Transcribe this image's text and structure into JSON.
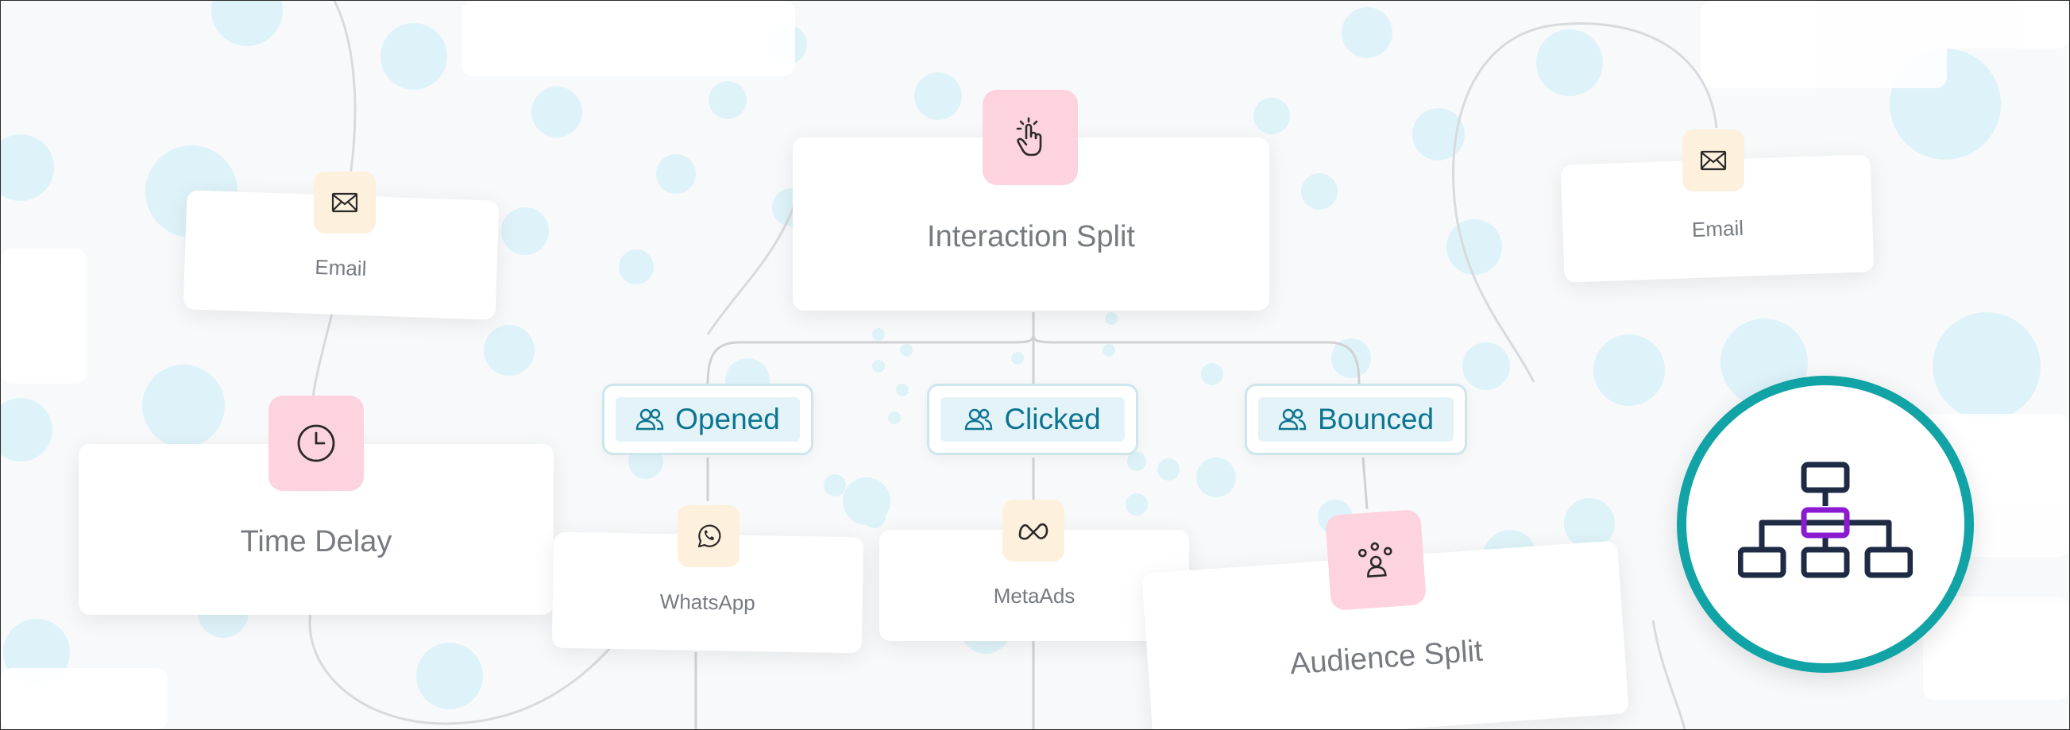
{
  "nodes": {
    "interaction_split": "Interaction Split",
    "time_delay": "Time Delay",
    "email_left": "Email",
    "email_right": "Email",
    "whatsapp": "WhatsApp",
    "metaads": "MetaAds",
    "audience_split": "Audience Split"
  },
  "branches": {
    "opened": "Opened",
    "clicked": "Clicked",
    "bounced": "Bounced"
  },
  "icons": {
    "interaction_split": "pointer-click-icon",
    "time_delay": "clock-icon",
    "email": "envelope-icon",
    "whatsapp": "whatsapp-icon",
    "metaads": "meta-logo-icon",
    "audience_split": "people-group-icon",
    "branch": "users-icon",
    "badge": "flowchart-hierarchy-icon"
  },
  "colors": {
    "accent_teal": "#11a3a6",
    "branch_text": "#0d7591",
    "pink_tile": "#fcd3df",
    "cream_tile": "#fdf0dc",
    "badge_navy": "#1f2a44",
    "badge_purple": "#8a1bd1"
  }
}
